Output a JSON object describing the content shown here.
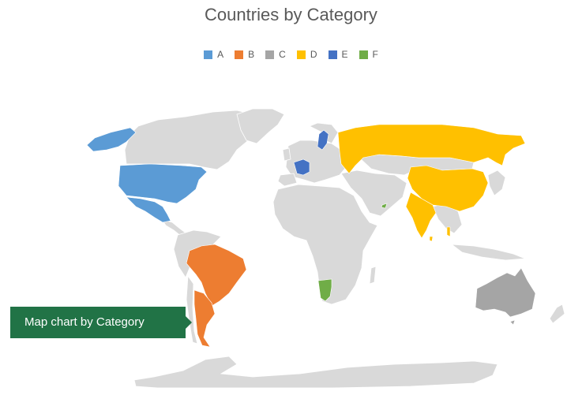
{
  "chart_data": {
    "type": "choropleth-map",
    "title": "Countries by Category",
    "legend_position": "top",
    "categories": [
      {
        "key": "A",
        "label": "A",
        "color": "#5b9bd5"
      },
      {
        "key": "B",
        "label": "B",
        "color": "#ed7d31"
      },
      {
        "key": "C",
        "label": "C",
        "color": "#a5a5a5"
      },
      {
        "key": "D",
        "label": "D",
        "color": "#ffc000"
      },
      {
        "key": "E",
        "label": "E",
        "color": "#4472c4"
      },
      {
        "key": "F",
        "label": "F",
        "color": "#70ad47"
      }
    ],
    "default_land_color": "#d9d9d9",
    "countries": [
      {
        "name": "United States",
        "category": "A"
      },
      {
        "name": "Mexico",
        "category": "A"
      },
      {
        "name": "Brazil",
        "category": "B"
      },
      {
        "name": "Argentina",
        "category": "B"
      },
      {
        "name": "Australia",
        "category": "C"
      },
      {
        "name": "Russia",
        "category": "D"
      },
      {
        "name": "China",
        "category": "D"
      },
      {
        "name": "India",
        "category": "D"
      },
      {
        "name": "Sri Lanka",
        "category": "D"
      },
      {
        "name": "France",
        "category": "E"
      },
      {
        "name": "Sweden",
        "category": "E"
      },
      {
        "name": "Namibia",
        "category": "F"
      },
      {
        "name": "United Arab Emirates",
        "category": "F"
      }
    ]
  },
  "callout": {
    "label": "Map chart by Category",
    "color": "#217346"
  }
}
